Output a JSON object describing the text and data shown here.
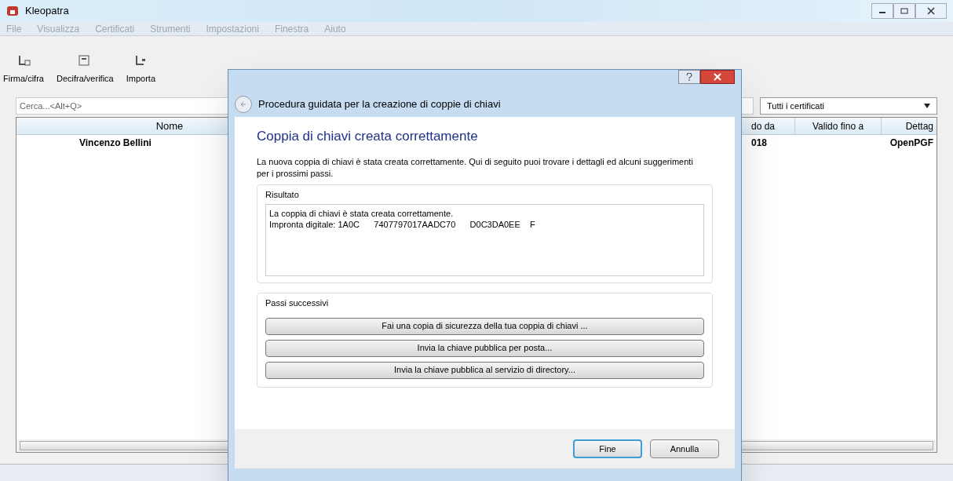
{
  "window": {
    "title": "Kleopatra"
  },
  "menu": [
    "File",
    "Visualizza",
    "Certificati",
    "Strumenti",
    "Impostazioni",
    "Finestra",
    "Aiuto"
  ],
  "toolbar": [
    {
      "label": "Firma/cifra"
    },
    {
      "label": "Decifra/verifica"
    },
    {
      "label": "Importa"
    }
  ],
  "search": {
    "placeholder": "Cerca...<Alt+Q>"
  },
  "filter": {
    "value": "Tutti i certificati"
  },
  "table": {
    "columns": [
      "Nome",
      "do da",
      "Valido fino a",
      "Dettag"
    ],
    "rows": [
      [
        "Vincenzo Bellini",
        "018",
        "",
        "OpenPGF"
      ]
    ]
  },
  "dialog": {
    "title": "Procedura guidata per la creazione di coppie di chiavi",
    "heading": "Coppia di chiavi creata correttamente",
    "intro": "La nuova coppia di chiavi è stata creata correttamente. Qui di seguito puoi trovare i dettagli ed alcuni suggerimenti per i prossimi passi.",
    "result": {
      "label": "Risultato",
      "lines": [
        "La coppia di chiavi è stata creata correttamente.",
        "Impronta digitale: 1A0C      7407797017AADC70      D0C3DA0EE    F"
      ]
    },
    "next_steps": {
      "label": "Passi successivi",
      "buttons": [
        "Fai una copia di sicurezza della tua coppia di chiavi ...",
        "Invia la chiave pubblica per posta...",
        "Invia la chiave pubblica al servizio di directory..."
      ]
    },
    "footer_buttons": [
      {
        "label": "Fine",
        "default": true
      },
      {
        "label": "Annulla",
        "default": false
      }
    ]
  }
}
